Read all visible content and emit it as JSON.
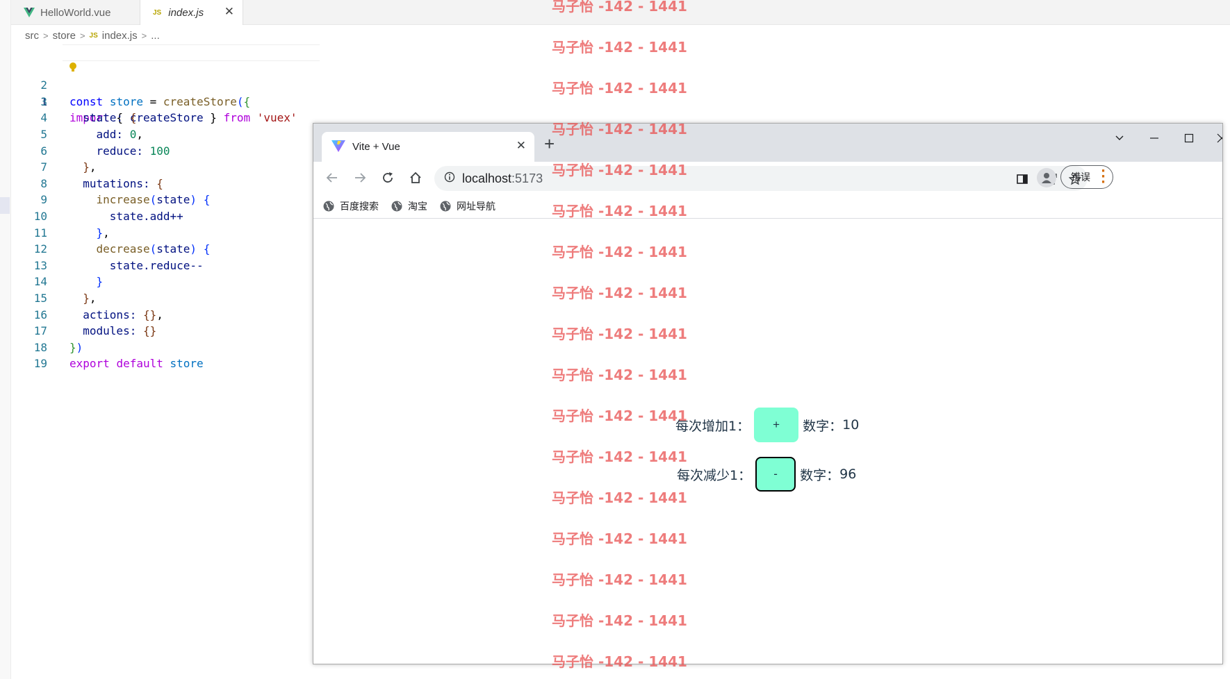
{
  "editor": {
    "tabs": [
      {
        "label": "HelloWorld.vue"
      },
      {
        "label": "index.js"
      }
    ],
    "breadcrumb": [
      "src",
      "store",
      "index.js",
      "..."
    ],
    "sep": ">",
    "js_icon_label": "JS",
    "line_numbers": [
      "1",
      "2",
      "3",
      "4",
      "5",
      "6",
      "7",
      "8",
      "9",
      "10",
      "11",
      "12",
      "13",
      "14",
      "15",
      "16",
      "17",
      "18",
      "19"
    ],
    "code": {
      "l1": {
        "import": "import",
        "open": " { ",
        "fn": "createStore",
        "close": " } ",
        "from": "from",
        "sp": " ",
        "str": "'vuex'"
      },
      "l2": {
        "const": "const",
        "sp1": " ",
        "name": "store",
        "eq": " = ",
        "fn": "createStore",
        "p": "(",
        "b": "{"
      },
      "l3": {
        "prop": "  state: ",
        "b": "{"
      },
      "l4": {
        "prop": "    add: ",
        "num": "0",
        "comma": ","
      },
      "l5": {
        "prop": "    reduce: ",
        "num": "100"
      },
      "l6": {
        "b": "  }",
        "comma": ","
      },
      "l7": {
        "prop": "  mutations: ",
        "b": "{"
      },
      "l8": {
        "indent": "    ",
        "fn": "increase",
        "p": "(",
        "arg": "state",
        "p2": ")",
        "sp": " ",
        "b": "{"
      },
      "l9": {
        "text": "      state.add++"
      },
      "l10": {
        "b": "    }",
        "comma": ","
      },
      "l11": {
        "indent": "    ",
        "fn": "decrease",
        "p": "(",
        "arg": "state",
        "p2": ")",
        "sp": " ",
        "b": "{"
      },
      "l12": {
        "text": "      state.reduce--"
      },
      "l13": {
        "b": "    }"
      },
      "l14": {
        "b": "  }",
        "comma": ","
      },
      "l15": {
        "prop": "  actions: ",
        "b": "{}",
        "comma": ","
      },
      "l16": {
        "prop": "  modules: ",
        "b": "{}"
      },
      "l17": {
        "b1": "}",
        "b2": ")"
      },
      "l18": {
        "export": "export",
        "sp": " ",
        "default": "default",
        "sp2": " ",
        "name": "store"
      }
    }
  },
  "browser": {
    "tab_title": "Vite + Vue",
    "tab_close": "✕",
    "new_tab": "+",
    "url_host": "localhost",
    "url_port": ":5173",
    "error_button": "错误",
    "bookmarks": [
      "百度搜索",
      "淘宝",
      "网址导航"
    ],
    "page": {
      "row1_label": "每次增加1：",
      "row1_button": "+",
      "row1_count_label": "数字：",
      "row1_count_value": "10",
      "row2_label": "每次减少1：",
      "row2_button": "-",
      "row2_count_label": "数字：",
      "row2_count_value": "96"
    }
  },
  "watermark": {
    "text": "马子怡 -142 - 1441"
  },
  "colors": {
    "counter_button": "#7fffd4",
    "watermark": "#e85050",
    "titlebar": "#dee1e6"
  },
  "icons": [
    "vue-icon",
    "js-icon",
    "close-icon",
    "lightbulb-icon",
    "vite-icon",
    "back-arrow-icon",
    "forward-arrow-icon",
    "reload-icon",
    "home-icon",
    "info-icon",
    "share-icon",
    "star-icon",
    "side-panel-icon",
    "profile-icon",
    "globe-icon",
    "chevron-down-icon",
    "minimize-icon",
    "maximize-icon",
    "window-close-icon"
  ]
}
